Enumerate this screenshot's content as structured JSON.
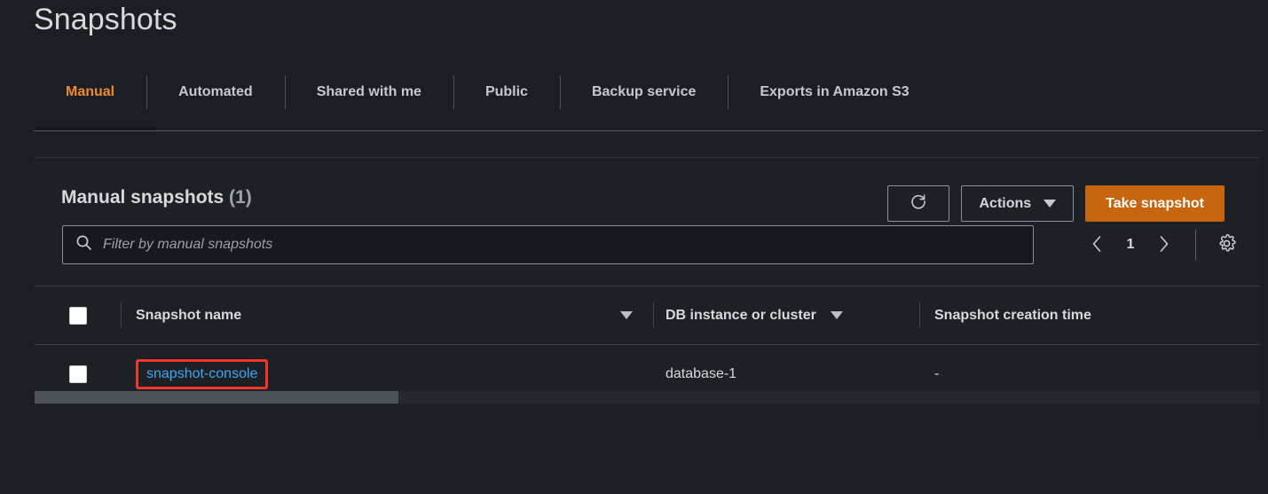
{
  "page": {
    "title": "Snapshots"
  },
  "tabs": [
    {
      "label": "Manual",
      "active": true
    },
    {
      "label": "Automated",
      "active": false
    },
    {
      "label": "Shared with me",
      "active": false
    },
    {
      "label": "Public",
      "active": false
    },
    {
      "label": "Backup service",
      "active": false
    },
    {
      "label": "Exports in Amazon S3",
      "active": false
    }
  ],
  "panel": {
    "title": "Manual snapshots",
    "count": "(1)",
    "refresh_icon": "refresh-icon",
    "actions_label": "Actions",
    "take_snapshot_label": "Take snapshot"
  },
  "search": {
    "icon": "search-icon",
    "placeholder": "Filter by manual snapshots",
    "value": ""
  },
  "pagination": {
    "prev_icon": "chevron-left-icon",
    "page": "1",
    "next_icon": "chevron-right-icon",
    "settings_icon": "gear-icon"
  },
  "table": {
    "columns": [
      {
        "label": "Snapshot name",
        "sortable": true
      },
      {
        "label": "DB instance or cluster",
        "sortable": true
      },
      {
        "label": "Snapshot creation time",
        "sortable": false
      }
    ],
    "rows": [
      {
        "snapshot_name": "snapshot-console",
        "db_instance": "database-1",
        "creation_time": "-",
        "highlighted": true
      }
    ]
  },
  "colors": {
    "accent_orange": "#c8650f",
    "tab_active": "#f0892a",
    "link_blue": "#3da6f5",
    "highlight_red": "#f5342a",
    "background": "#1b1f23",
    "panel": "#1d2125"
  }
}
